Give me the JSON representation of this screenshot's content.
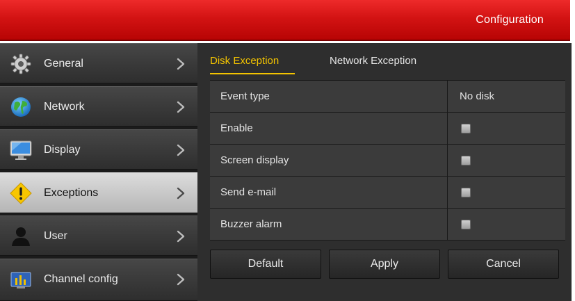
{
  "window": {
    "title": "Configuration"
  },
  "sidebar": {
    "items": [
      {
        "label": "General",
        "icon": "gear-icon",
        "active": false
      },
      {
        "label": "Network",
        "icon": "globe-icon",
        "active": false
      },
      {
        "label": "Display",
        "icon": "monitor-icon",
        "active": false
      },
      {
        "label": "Exceptions",
        "icon": "warning-icon",
        "active": true
      },
      {
        "label": "User",
        "icon": "user-icon",
        "active": false
      },
      {
        "label": "Channel config",
        "icon": "channel-config-icon",
        "active": false
      }
    ]
  },
  "main": {
    "tabs": [
      {
        "label": "Disk Exception",
        "active": true
      },
      {
        "label": "Network Exception",
        "active": false
      }
    ],
    "rows": [
      {
        "label": "Event type",
        "value": "No disk"
      },
      {
        "label": "Enable",
        "checked": false
      },
      {
        "label": "Screen display",
        "checked": false
      },
      {
        "label": "Send e-mail",
        "checked": false
      },
      {
        "label": "Buzzer alarm",
        "checked": false
      }
    ],
    "buttons": {
      "default_label": "Default",
      "apply_label": "Apply",
      "cancel_label": "Cancel"
    }
  },
  "colors": {
    "title_bar": "#d31313",
    "active_tab": "#f4c400",
    "panel": "#2e2e2e",
    "row": "#3b3b3b"
  }
}
